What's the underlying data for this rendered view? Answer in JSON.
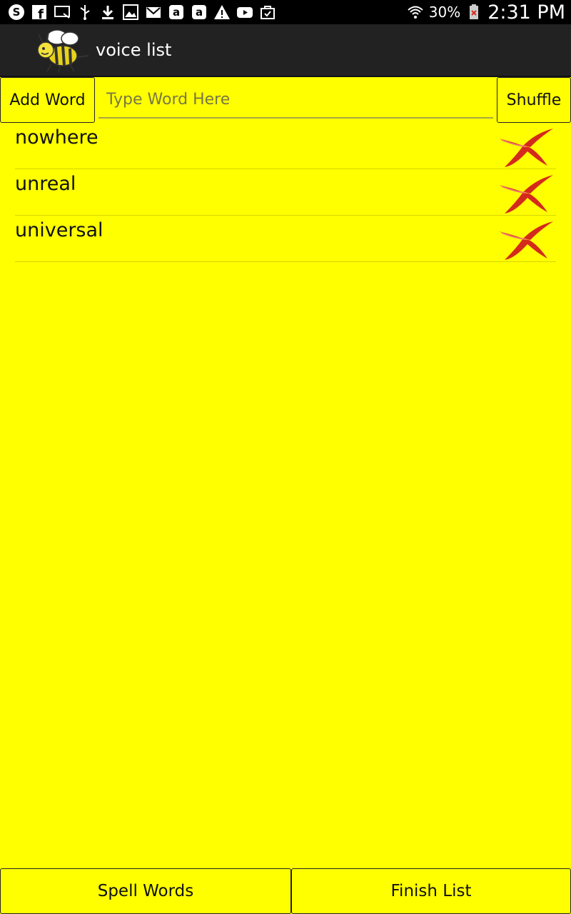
{
  "status_bar": {
    "icons_left": [
      "skype-icon",
      "facebook-icon",
      "cast-icon",
      "usb-icon",
      "download-icon",
      "gallery-icon",
      "gmail-icon",
      "amazon-icon",
      "amazon-icon-2",
      "warning-icon",
      "youtube-icon",
      "bag-check-icon"
    ],
    "battery_percent": "30%",
    "time": "2:31 PM"
  },
  "action_bar": {
    "title": "voice list"
  },
  "input_row": {
    "add_label": "Add Word",
    "input_value": "",
    "input_placeholder": "Type Word Here",
    "shuffle_label": "Shuffle"
  },
  "words": [
    {
      "text": "nowhere"
    },
    {
      "text": "unreal"
    },
    {
      "text": "universal"
    }
  ],
  "bottom": {
    "spell_label": "Spell Words",
    "finish_label": "Finish List"
  },
  "colors": {
    "background": "#ffff00",
    "action_bar": "#222222",
    "status_bar": "#000000",
    "delete_red": "#d42a1c"
  }
}
